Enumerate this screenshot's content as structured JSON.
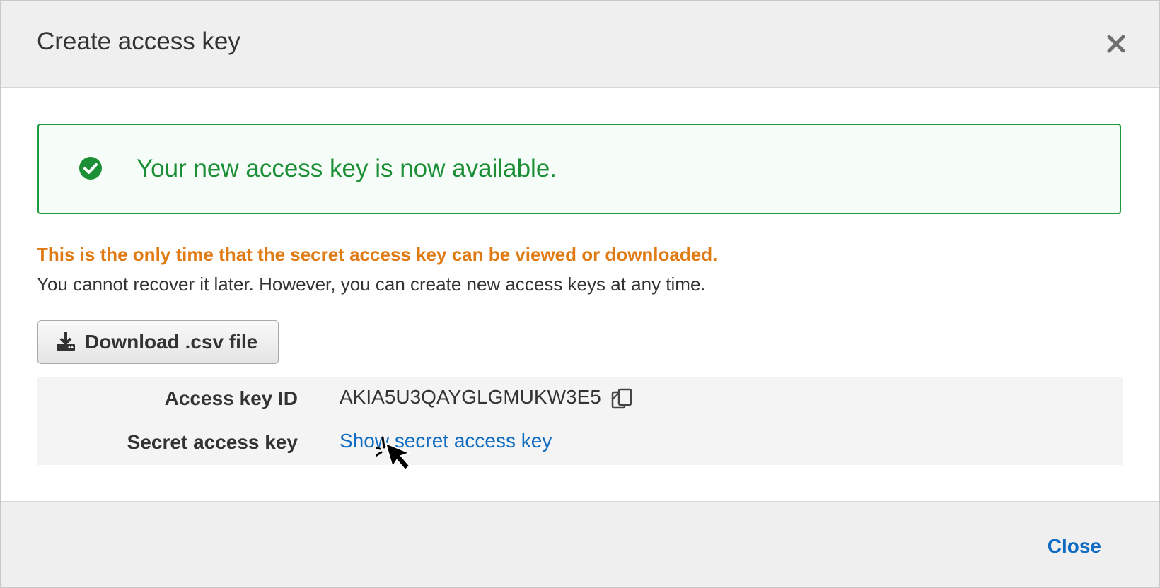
{
  "dialog": {
    "title": "Create access key",
    "close_icon": "close-icon"
  },
  "alert": {
    "icon": "check-circle-icon",
    "message": "Your new access key is now available.",
    "color": "#1b8f35"
  },
  "warning": {
    "headline": "This is the only time that the secret access key can be viewed or downloaded.",
    "detail": "You cannot recover it later. However, you can create new access keys at any time.",
    "color": "#e07a12"
  },
  "download": {
    "icon": "download-icon",
    "label": "Download .csv file"
  },
  "keys": {
    "access_key_id_label": "Access key ID",
    "access_key_id_value": "AKIA5U3QAYGLGMUKW3E5",
    "copy_icon": "copy-icon",
    "secret_label": "Secret access key",
    "show_secret_link": "Show secret access key"
  },
  "footer": {
    "close_label": "Close"
  },
  "colors": {
    "link": "#0f6cc2",
    "header_bg": "#efefef"
  }
}
